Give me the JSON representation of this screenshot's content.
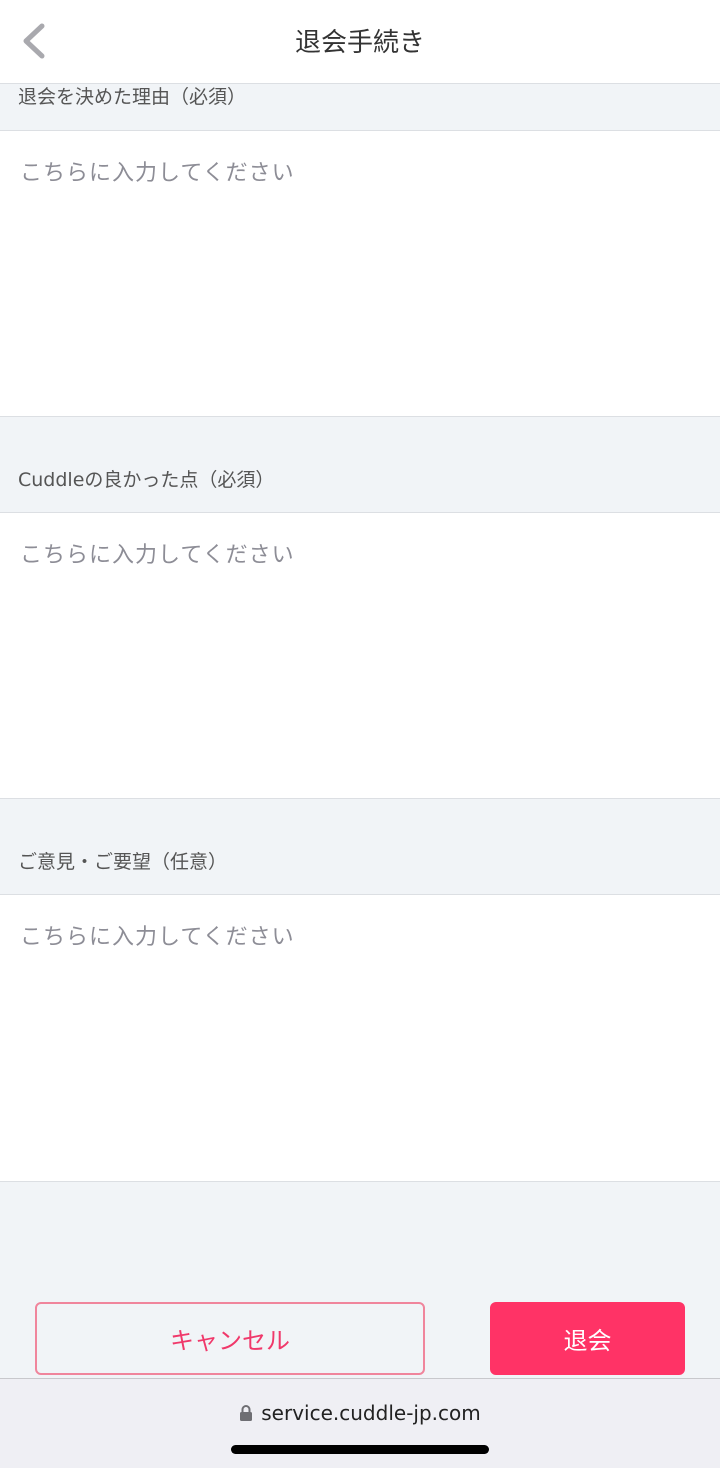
{
  "header": {
    "title": "退会手続き",
    "back_icon": "chevron-left-icon"
  },
  "form": {
    "fields": [
      {
        "label": "退会を決めた理由（必須）",
        "placeholder": "こちらに入力してください",
        "value": ""
      },
      {
        "label": "Cuddleの良かった点（必須）",
        "placeholder": "こちらに入力してください",
        "value": ""
      },
      {
        "label": "ご意見・ご要望（任意）",
        "placeholder": "こちらに入力してください",
        "value": ""
      }
    ]
  },
  "actions": {
    "cancel_label": "キャンセル",
    "withdraw_label": "退会"
  },
  "browser": {
    "url": "service.cuddle-jp.com",
    "lock_icon": "lock-icon"
  },
  "colors": {
    "accent": "#ff3366",
    "cancel_text": "#f0386a",
    "cancel_border": "#f0859c",
    "background": "#f1f4f7"
  }
}
